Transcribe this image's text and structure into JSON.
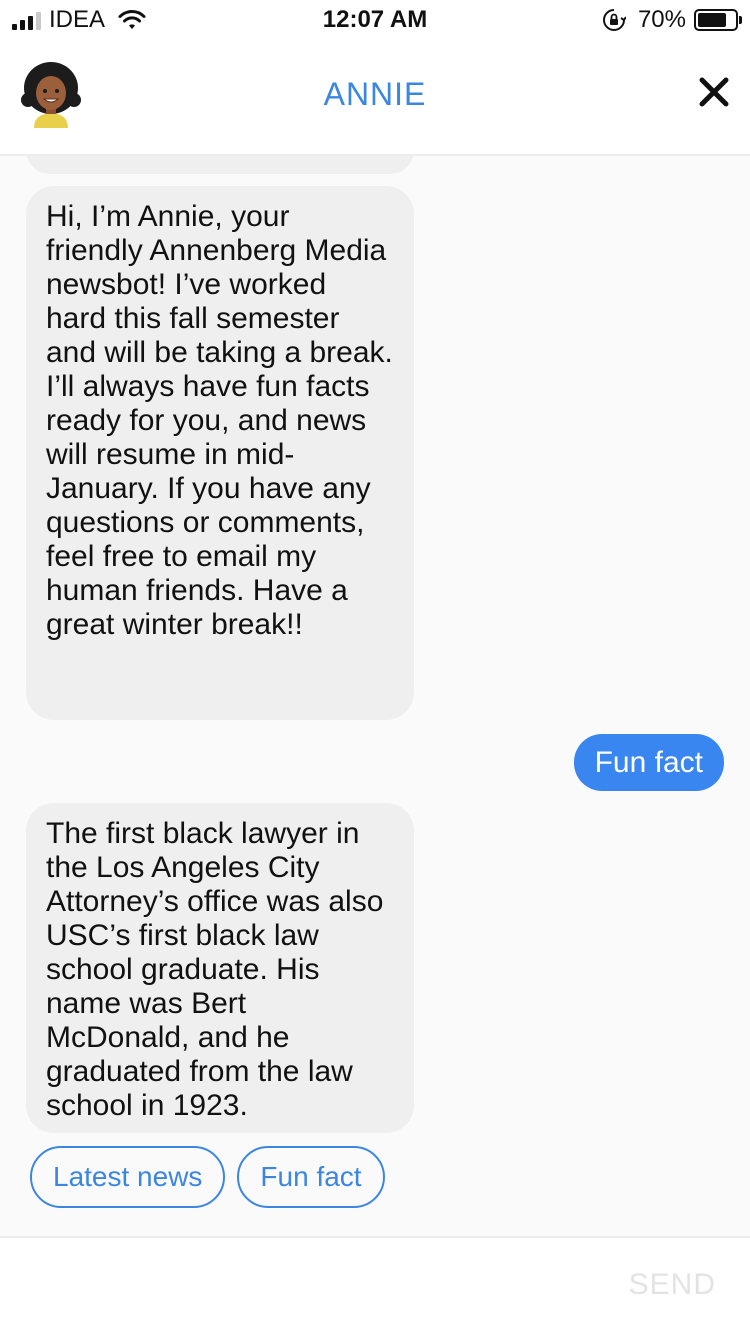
{
  "status_bar": {
    "carrier": "IDEA",
    "time": "12:07 AM",
    "battery_percent": "70%",
    "battery_level": 0.7,
    "icons": [
      "signal-icon",
      "wifi-icon",
      "rotation-lock-icon",
      "battery-icon"
    ]
  },
  "header": {
    "title": "ANNIE",
    "avatar_icon": "bot-avatar-icon",
    "close_icon": "close-icon"
  },
  "messages": [
    {
      "sender": "bot",
      "text": "Hi, I’m Annie, your friendly Annenberg Media newsbot! I’ve worked hard this fall semester and will be taking a break. I’ll always have fun facts ready for you, and news will resume in mid-January. If you have any questions or comments, feel free to email my human friends. Have a great winter break!!"
    },
    {
      "sender": "user",
      "text": "Fun fact"
    },
    {
      "sender": "bot",
      "text": "The first black lawyer in the Los Angeles City Attorney’s office was also USC’s first black law school graduate. His name was Bert McDonald, and he graduated from the law school in 1923."
    }
  ],
  "quick_replies": [
    "Latest news",
    "Fun fact"
  ],
  "composer": {
    "value": "",
    "placeholder": "",
    "send_label": "SEND"
  },
  "colors": {
    "accent": "#3a86e0",
    "user_bubble": "#3a86f0",
    "bot_bubble": "#efefef",
    "background": "#fafafa"
  }
}
